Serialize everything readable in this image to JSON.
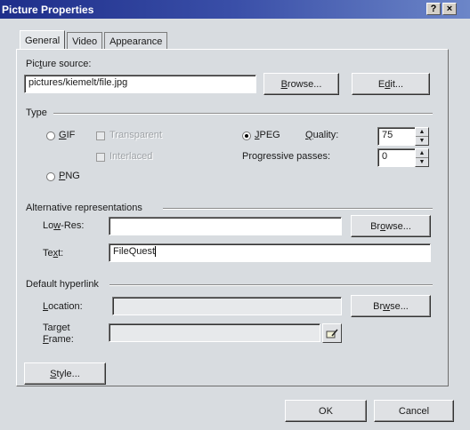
{
  "window": {
    "title": "Picture Properties",
    "help_label": "?",
    "close_label": "×"
  },
  "tabs": [
    {
      "label": "General"
    },
    {
      "label": "Video"
    },
    {
      "label": "Appearance"
    }
  ],
  "picture_source": {
    "label_pre": "Pic",
    "label_accel": "t",
    "label_post": "ure source:",
    "value": "pictures/kiemelt/file.jpg",
    "browse_pre": "",
    "browse_accel": "B",
    "browse_post": "rowse...",
    "edit_pre": "E",
    "edit_accel": "d",
    "edit_post": "it..."
  },
  "type_group": {
    "title": "Type",
    "gif_label_accel": "G",
    "gif_label_post": "IF",
    "transparent_label": "Transparent",
    "interlaced_label": "Interlaced",
    "jpeg_label_accel": "J",
    "jpeg_label_post": "PEG",
    "quality_label_accel": "Q",
    "quality_label_post": "uality:",
    "quality_value": "75",
    "progressive_label": "Progressive passes:",
    "progressive_value": "0",
    "png_label_accel": "P",
    "png_label_post": "NG",
    "selected": "JPEG"
  },
  "alt_group": {
    "title": "Alternative representations",
    "lowres_pre": "Lo",
    "lowres_accel": "w",
    "lowres_post": "-Res:",
    "lowres_value": "",
    "browse_pre": "Br",
    "browse_accel": "o",
    "browse_post": "wse...",
    "text_pre": "Te",
    "text_accel": "x",
    "text_post": "t:",
    "text_value": "FileQuest"
  },
  "hyperlink_group": {
    "title": "Default hyperlink",
    "location_accel": "L",
    "location_post": "ocation:",
    "location_value": "",
    "browse_pre": "Br",
    "browse_accel": "w",
    "browse_post": "se...",
    "target_line1": "Target",
    "target_accel": "F",
    "target_post": "rame:",
    "target_value": ""
  },
  "style_button": {
    "pre": "",
    "accel": "S",
    "post": "tyle..."
  },
  "footer": {
    "ok_label": "OK",
    "cancel_label": "Cancel"
  },
  "colors": {
    "titlebar": "#1e2e8a",
    "face": "#d8dce0"
  }
}
